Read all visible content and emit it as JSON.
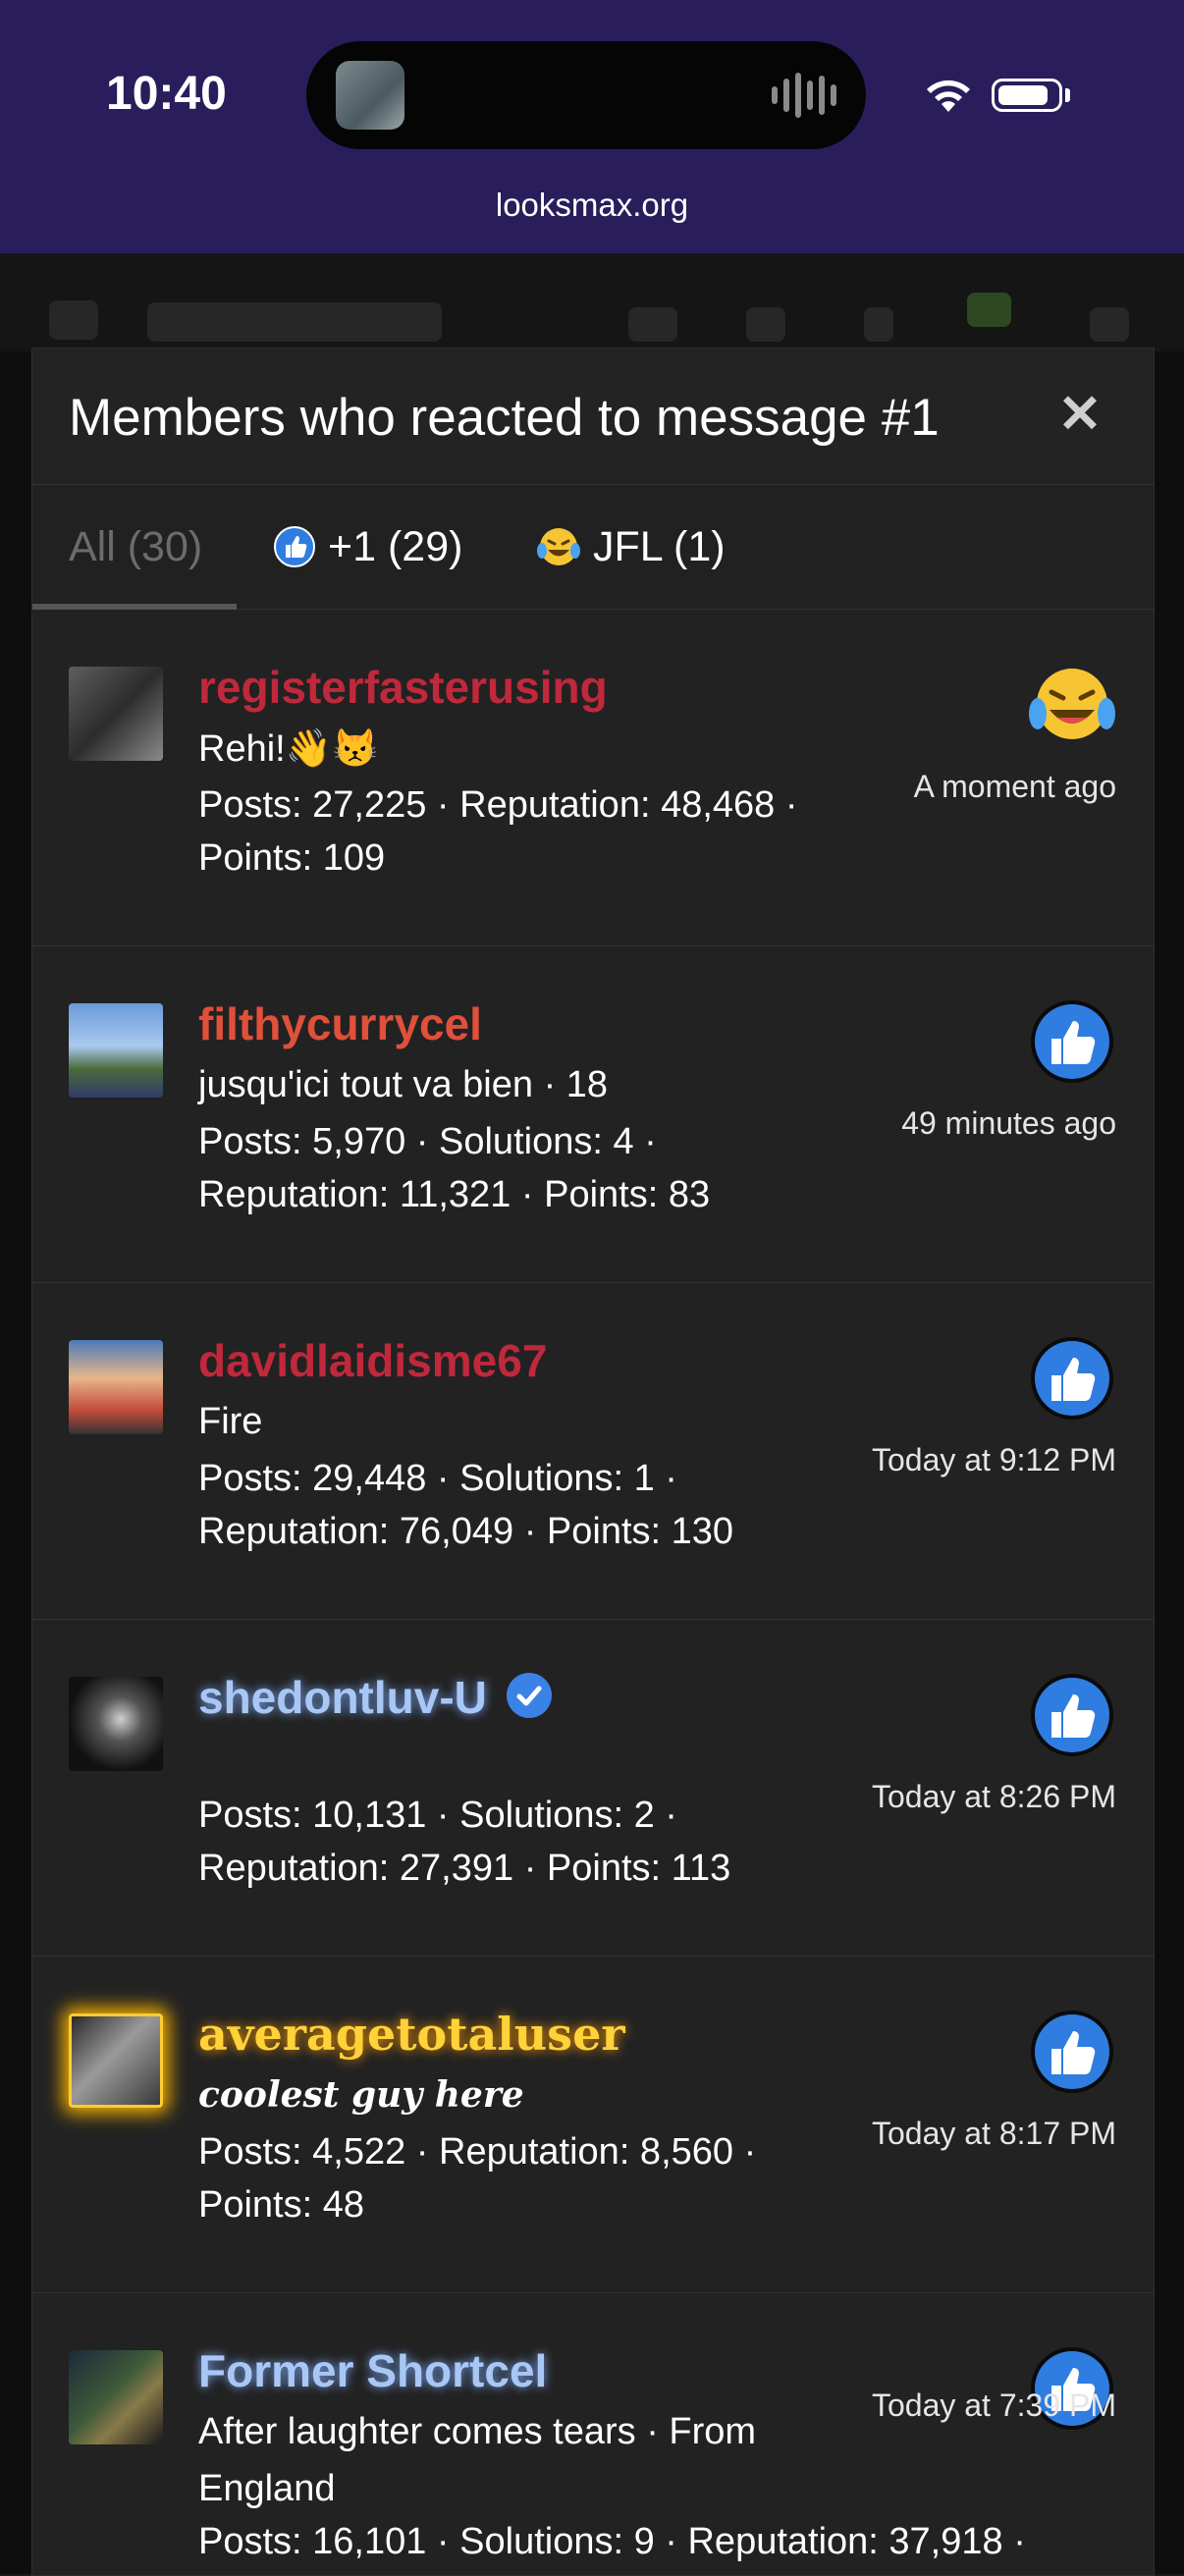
{
  "status_bar": {
    "time": "10:40",
    "url": "looksmax.org",
    "icons": [
      "wifi-icon",
      "battery-icon"
    ]
  },
  "modal": {
    "title": "Members who reacted to message #1",
    "close_icon": "close-icon",
    "tabs": [
      {
        "label": "All (30)",
        "icon": null,
        "active": true
      },
      {
        "label": "+1 (29)",
        "icon": "thumbs-up-icon",
        "active": false
      },
      {
        "label": "JFL (1)",
        "icon": "laughing-crying-icon",
        "active": false
      }
    ]
  },
  "members": [
    {
      "username": "registerfasterusing",
      "title": "Rehi!👋😾",
      "stats_line1": "Posts: 27,225 · Reputation: 48,468 ·",
      "stats_line2": "Points: 109",
      "stats_line3": "",
      "reaction": "laughing-crying-icon",
      "time": "A moment ago"
    },
    {
      "username": "filthycurrycel",
      "title": "jusqu'ici tout va bien · 18",
      "stats_line1": "Posts: 5,970 · Solutions: 4 ·",
      "stats_line2": "Reputation: 11,321 · Points: 83",
      "stats_line3": "",
      "reaction": "thumbs-up-icon",
      "time": "49 minutes ago"
    },
    {
      "username": "davidlaidisme67",
      "title": "Fire",
      "stats_line1": "Posts: 29,448 · Solutions: 1 ·",
      "stats_line2": "Reputation: 76,049 · Points: 130",
      "stats_line3": "",
      "reaction": "thumbs-up-icon",
      "time": "Today at 9:12 PM"
    },
    {
      "username": "shedontluv-U",
      "title": "",
      "stats_line1": "Posts: 10,131 · Solutions: 2 ·",
      "stats_line2": "Reputation: 27,391 · Points: 113",
      "stats_line3": "",
      "reaction": "thumbs-up-icon",
      "time": "Today at 8:26 PM"
    },
    {
      "username": "averagetotaluser",
      "title": "coolest guy here",
      "stats_line1": "Posts: 4,522 · Reputation: 8,560 ·",
      "stats_line2": "Points: 48",
      "stats_line3": "",
      "reaction": "thumbs-up-icon",
      "time": "Today at 8:17 PM"
    },
    {
      "username": "Former Shortcel",
      "title": "After laughter comes tears · From",
      "stats_line1": "England",
      "stats_line2": "Posts: 16,101 · Solutions: 9 · Reputation: 37,918 ·",
      "stats_line3": "",
      "reaction": "thumbs-up-icon",
      "time": "Today at 7:39 PM"
    }
  ]
}
